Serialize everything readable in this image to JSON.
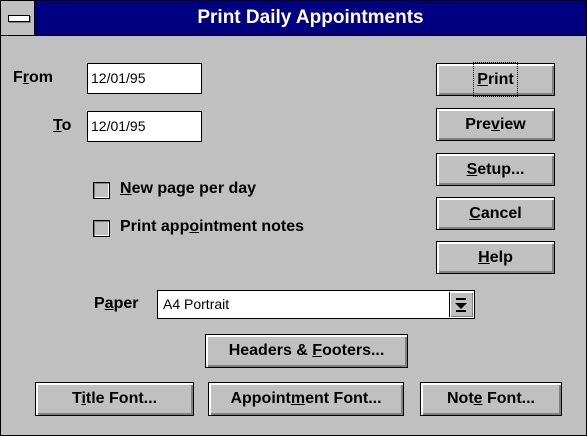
{
  "window": {
    "title": "Print Daily Appointments"
  },
  "from": {
    "label_pre": "F",
    "label_u": "r",
    "label_post": "om",
    "value": "12/01/95"
  },
  "to": {
    "label_pre": "",
    "label_u": "T",
    "label_post": "o",
    "value": "12/01/95"
  },
  "options": [
    {
      "pre": "",
      "u": "N",
      "post": "ew page per day",
      "checked": false
    },
    {
      "pre": "Print app",
      "u": "o",
      "post": "intment notes",
      "checked": false
    }
  ],
  "buttons": {
    "print": {
      "pre": "",
      "u": "P",
      "post": "rint"
    },
    "preview": {
      "pre": "Pre",
      "u": "v",
      "post": "iew"
    },
    "setup": {
      "pre": "",
      "u": "S",
      "post": "etup..."
    },
    "cancel": {
      "pre": "",
      "u": "C",
      "post": "ancel"
    },
    "help": {
      "pre": "",
      "u": "H",
      "post": "elp"
    },
    "headers": {
      "pre": "Headers & ",
      "u": "F",
      "post": "ooters..."
    },
    "title_font": {
      "pre": "T",
      "u": "i",
      "post": "tle Font..."
    },
    "appt_font": {
      "pre": "Appoint",
      "u": "m",
      "post": "ent Font..."
    },
    "note_font": {
      "pre": "Not",
      "u": "e",
      "post": " Font..."
    }
  },
  "paper": {
    "label_pre": "P",
    "label_u": "a",
    "label_post": "per",
    "value": "A4  Portrait"
  },
  "icons": {
    "system_menu": "system-menu-icon",
    "dropdown": "dropdown-arrow-icon"
  }
}
